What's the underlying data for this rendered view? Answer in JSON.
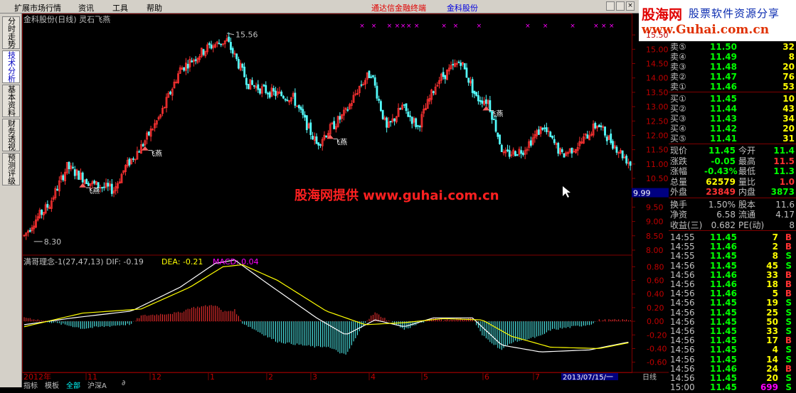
{
  "menu": {
    "items": [
      "扩展市场行情",
      "资讯",
      "工具",
      "帮助"
    ],
    "notice": "通达信金融终端",
    "stock_link": "金科股份"
  },
  "banner": {
    "logo": "股海网",
    "slogan": "股票软件资源分享",
    "url": "www.Guhai.com.cn"
  },
  "left_tabs": [
    "分时走势",
    "技术分析",
    "基本资料",
    "财务透视",
    "预测评级"
  ],
  "chart_header": {
    "title": "金科股份(日线) 灵石飞燕"
  },
  "watermark": "股海网提供 www.guhai.com.cn",
  "indicator_header": {
    "name": "满哥理念-1(27,47,13)",
    "dif": "DIF: -0.19",
    "dea": "DEA: -0.21",
    "macd": "MACD: 0.04"
  },
  "annotations": {
    "high": "15.56",
    "low": "8.30",
    "signal": "飞燕",
    "current_price": "9.99"
  },
  "signal_label": "飞燕",
  "colors": {
    "up": "#ff3232",
    "down": "#54fcfc",
    "grid": "#800000",
    "dif": "#ffffff",
    "dea": "#ffff00",
    "macd": "#ff00ff"
  },
  "x_axis": {
    "labels": [
      "2012年",
      "11",
      "12",
      "1",
      "2",
      "3",
      "4",
      "5",
      "6",
      "7"
    ],
    "date_box": "2013/07/15/一",
    "period": "日线"
  },
  "bottom_tabs": [
    "指标",
    "模板",
    "全部",
    "沪深A",
    "∂"
  ],
  "chart_data": {
    "type": "candlestick",
    "price_ticks": [
      "15.50",
      "15.00",
      "14.50",
      "14.00",
      "13.50",
      "13.00",
      "12.50",
      "12.00",
      "11.50",
      "11.00",
      "10.50",
      "10.00",
      "9.50",
      "9.00",
      "8.50",
      "8.00"
    ],
    "price_range": [
      7.9,
      15.85
    ],
    "macd_ticks": [
      "0.80",
      "0.60",
      "0.40",
      "0.20",
      "0.00",
      "-0.20",
      "-0.40",
      "-0.60"
    ],
    "macd_range": [
      -0.75,
      0.95
    ],
    "waypoints": [
      [
        0,
        8.5
      ],
      [
        5,
        9.0
      ],
      [
        13,
        9.6
      ],
      [
        22,
        10.9
      ],
      [
        35,
        10.3
      ],
      [
        46,
        10.1
      ],
      [
        52,
        10.9
      ],
      [
        60,
        11.6
      ],
      [
        70,
        12.7
      ],
      [
        80,
        14.3
      ],
      [
        95,
        15.1
      ],
      [
        104,
        15.3
      ],
      [
        115,
        13.8
      ],
      [
        126,
        13.5
      ],
      [
        138,
        13.3
      ],
      [
        150,
        11.7
      ],
      [
        158,
        12.3
      ],
      [
        165,
        12.8
      ],
      [
        172,
        13.7
      ],
      [
        178,
        14.2
      ],
      [
        186,
        12.2
      ],
      [
        194,
        13.0
      ],
      [
        202,
        12.3
      ],
      [
        212,
        13.9
      ],
      [
        224,
        14.6
      ],
      [
        232,
        13.3
      ],
      [
        238,
        13.2
      ],
      [
        246,
        11.3
      ],
      [
        256,
        11.5
      ],
      [
        266,
        12.3
      ],
      [
        276,
        11.3
      ],
      [
        285,
        11.7
      ],
      [
        294,
        12.4
      ],
      [
        301,
        11.8
      ],
      [
        311,
        11.0
      ]
    ],
    "dif_waypoints": [
      [
        0,
        -0.05
      ],
      [
        25,
        0.05
      ],
      [
        55,
        0.15
      ],
      [
        80,
        0.5
      ],
      [
        98,
        0.85
      ],
      [
        108,
        0.9
      ],
      [
        125,
        0.55
      ],
      [
        150,
        0.05
      ],
      [
        165,
        -0.2
      ],
      [
        180,
        0.02
      ],
      [
        195,
        -0.08
      ],
      [
        210,
        0.05
      ],
      [
        230,
        0.05
      ],
      [
        245,
        -0.35
      ],
      [
        265,
        -0.45
      ],
      [
        290,
        -0.42
      ],
      [
        311,
        -0.3
      ]
    ],
    "dea_waypoints": [
      [
        0,
        -0.08
      ],
      [
        30,
        0.12
      ],
      [
        60,
        0.18
      ],
      [
        85,
        0.5
      ],
      [
        102,
        0.8
      ],
      [
        112,
        0.83
      ],
      [
        130,
        0.6
      ],
      [
        155,
        0.15
      ],
      [
        175,
        -0.05
      ],
      [
        195,
        -0.02
      ],
      [
        215,
        0.04
      ],
      [
        235,
        0.02
      ],
      [
        250,
        -0.22
      ],
      [
        270,
        -0.38
      ],
      [
        295,
        -0.4
      ],
      [
        311,
        -0.31
      ]
    ],
    "signals": [
      [
        30,
        "飞燕"
      ],
      [
        62,
        "飞燕"
      ],
      [
        157,
        "飞燕"
      ],
      [
        237,
        "飞燕"
      ]
    ],
    "top_markers": [
      172,
      178,
      186,
      190,
      193,
      196,
      200,
      214,
      220,
      232,
      257,
      266,
      280,
      292,
      296,
      300
    ]
  },
  "quote": {
    "asks": [
      {
        "label": "卖⑤",
        "price": "11.50",
        "vol": "32"
      },
      {
        "label": "卖④",
        "price": "11.49",
        "vol": "8"
      },
      {
        "label": "卖③",
        "price": "11.48",
        "vol": "20"
      },
      {
        "label": "卖②",
        "price": "11.47",
        "vol": "76"
      },
      {
        "label": "卖①",
        "price": "11.46",
        "vol": "53"
      }
    ],
    "bids": [
      {
        "label": "买①",
        "price": "11.45",
        "vol": "10"
      },
      {
        "label": "买②",
        "price": "11.44",
        "vol": "43"
      },
      {
        "label": "买③",
        "price": "11.43",
        "vol": "34"
      },
      {
        "label": "买④",
        "price": "11.42",
        "vol": "20"
      },
      {
        "label": "买⑤",
        "price": "11.41",
        "vol": "31"
      }
    ],
    "stats": [
      {
        "l1": "现价",
        "v1": "11.45",
        "c1": "#00ff00",
        "l2": "今开",
        "v2": "11.4",
        "c2": "#00ff00"
      },
      {
        "l1": "涨跌",
        "v1": "-0.05",
        "c1": "#00ff00",
        "l2": "最高",
        "v2": "11.5",
        "c2": "#ff3232"
      },
      {
        "l1": "涨幅",
        "v1": "-0.43%",
        "c1": "#00ff00",
        "l2": "最低",
        "v2": "11.3",
        "c2": "#00ff00"
      },
      {
        "l1": "总量",
        "v1": "62579",
        "c1": "#ffff00",
        "l2": "量比",
        "v2": "1.0",
        "c2": "#ff3232"
      },
      {
        "l1": "外盘",
        "v1": "23849",
        "c1": "#ff3232",
        "l2": "内盘",
        "v2": "3873",
        "c2": "#00ff00"
      }
    ],
    "stats2": [
      {
        "l1": "换手",
        "v1": "1.50%",
        "l2": "股本",
        "v2": "11.6"
      },
      {
        "l1": "净资",
        "v1": "6.58",
        "l2": "流通",
        "v2": "4.17"
      },
      {
        "l1": "收益(三)",
        "v1": "0.682",
        "l2": "PE(动)",
        "v2": "8"
      }
    ],
    "ticks": [
      {
        "t": "14:55",
        "p": "11.45",
        "v": "7",
        "d": "B"
      },
      {
        "t": "14:55",
        "p": "11.46",
        "v": "2",
        "d": "B"
      },
      {
        "t": "14:55",
        "p": "11.45",
        "v": "8",
        "d": "S"
      },
      {
        "t": "14:56",
        "p": "11.45",
        "v": "45",
        "d": "S"
      },
      {
        "t": "14:56",
        "p": "11.46",
        "v": "33",
        "d": "B"
      },
      {
        "t": "14:56",
        "p": "11.46",
        "v": "18",
        "d": "B"
      },
      {
        "t": "14:56",
        "p": "11.46",
        "v": "5",
        "d": "B"
      },
      {
        "t": "14:56",
        "p": "11.45",
        "v": "19",
        "d": "S"
      },
      {
        "t": "14:56",
        "p": "11.45",
        "v": "25",
        "d": "S"
      },
      {
        "t": "14:56",
        "p": "11.45",
        "v": "50",
        "d": "S"
      },
      {
        "t": "14:56",
        "p": "11.45",
        "v": "33",
        "d": "S"
      },
      {
        "t": "14:56",
        "p": "11.45",
        "v": "17",
        "d": "B"
      },
      {
        "t": "14:56",
        "p": "11.45",
        "v": "4",
        "d": "S"
      },
      {
        "t": "14:56",
        "p": "11.45",
        "v": "14",
        "d": "S"
      },
      {
        "t": "14:56",
        "p": "11.46",
        "v": "24",
        "d": "B"
      },
      {
        "t": "14:56",
        "p": "11.45",
        "v": "20",
        "d": "S"
      },
      {
        "t": "15:00",
        "p": "11.45",
        "v": "699",
        "d": "S"
      }
    ]
  }
}
